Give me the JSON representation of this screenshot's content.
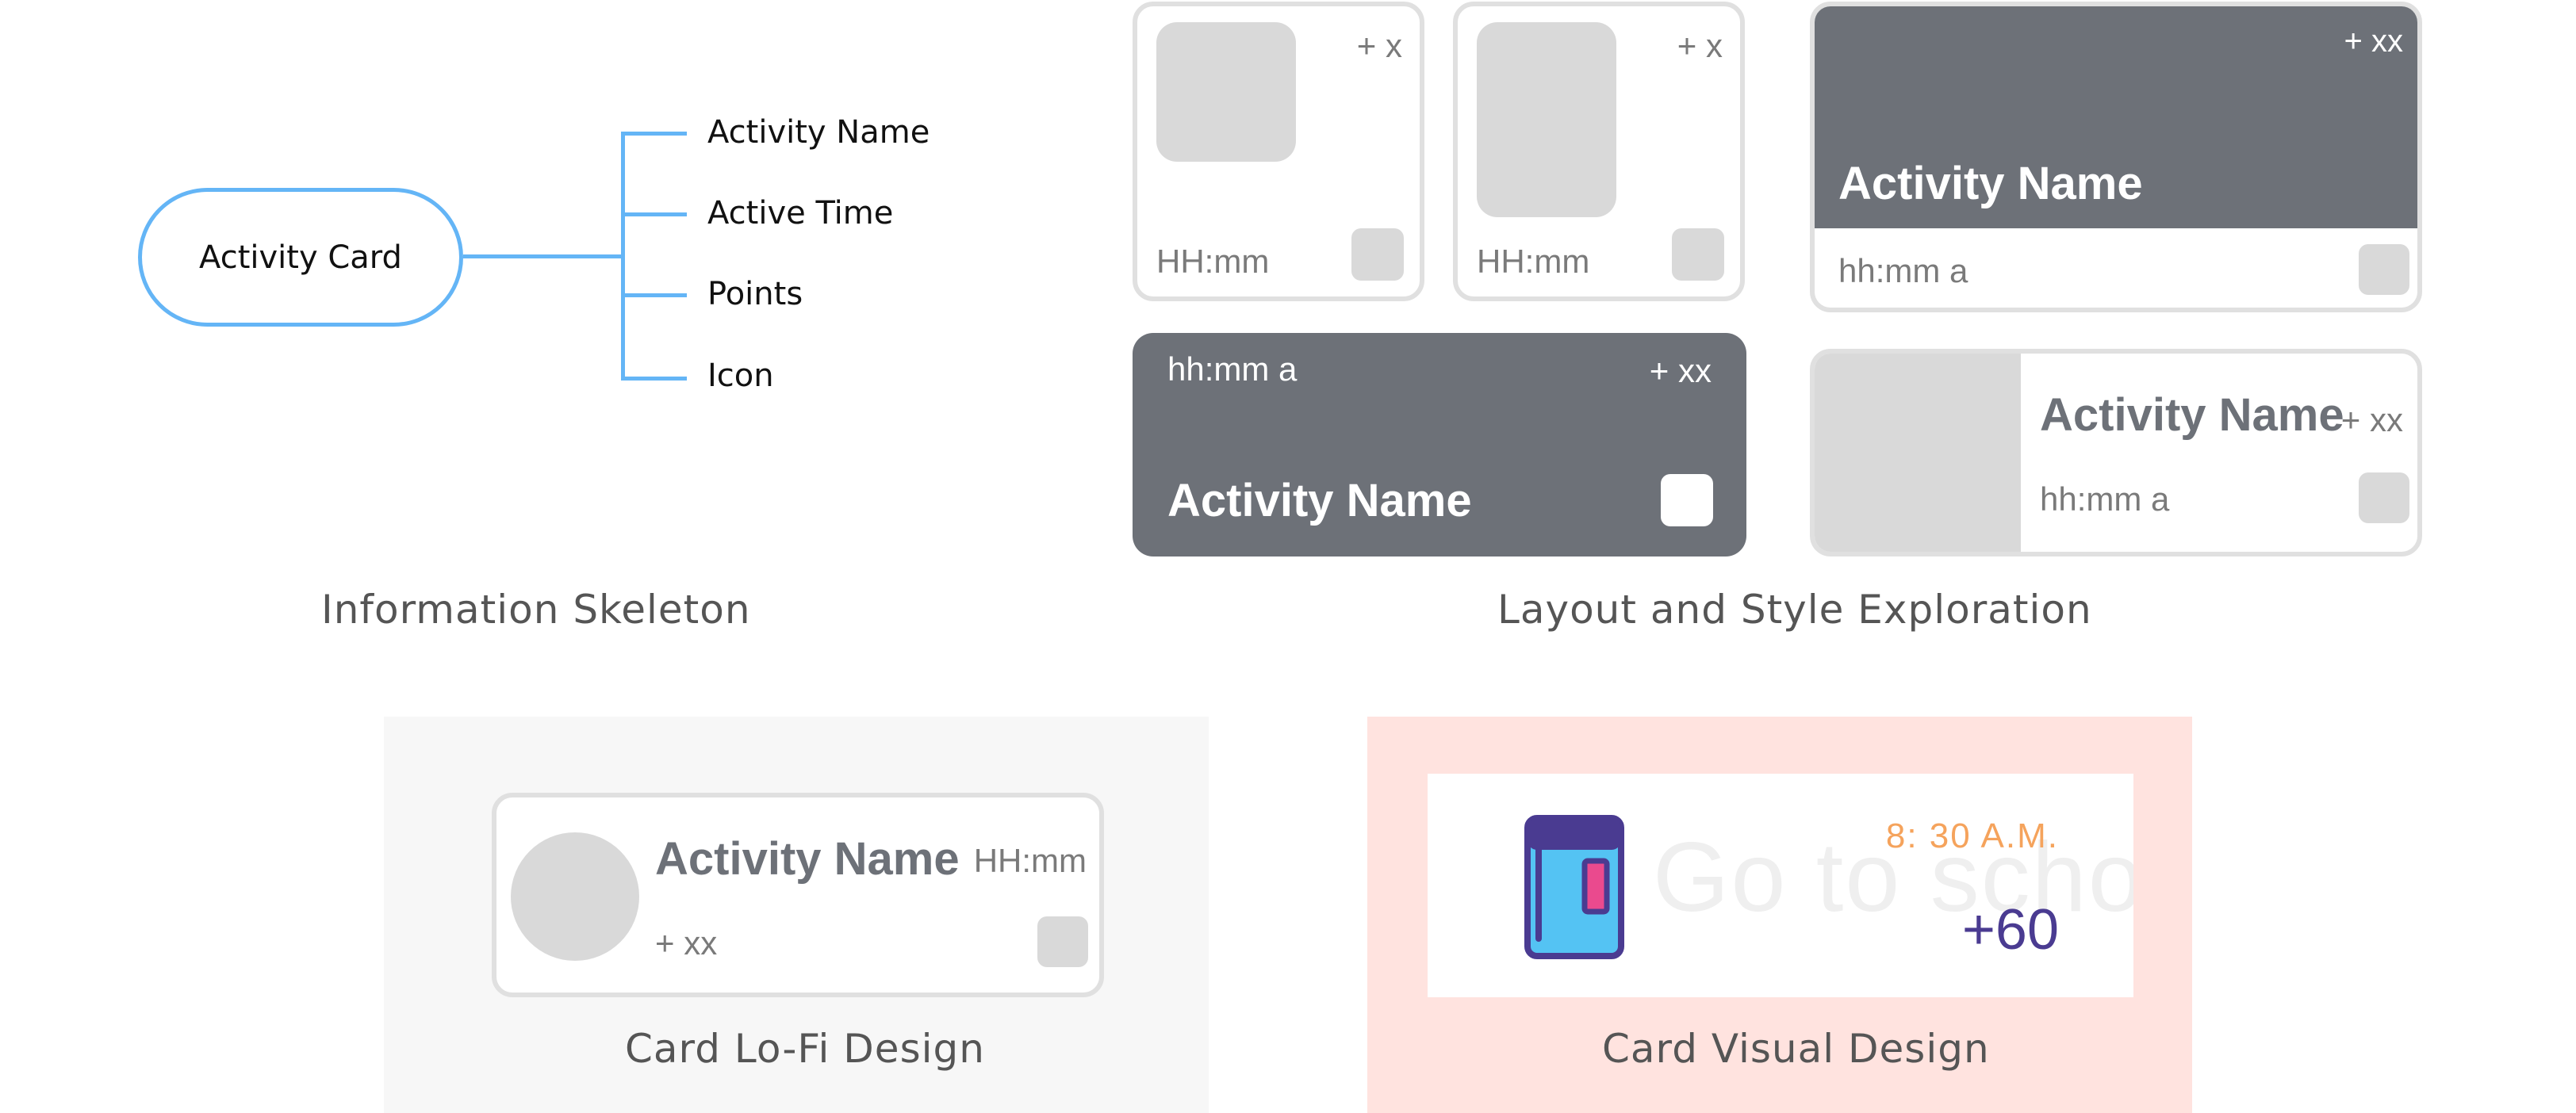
{
  "skeleton": {
    "root": "Activity Card",
    "children": [
      "Activity Name",
      "Active Time",
      "Points",
      "Icon"
    ],
    "caption": "Information Skeleton"
  },
  "exploration": {
    "caption": "Layout and Style Exploration",
    "card1": {
      "time": "HH:mm",
      "points": "+ x"
    },
    "card2": {
      "time": "HH:mm",
      "points": "+ x"
    },
    "card3": {
      "title": "Activity Name",
      "points": "+ xx",
      "time": "hh:mm a"
    },
    "card4": {
      "time": "hh:mm a",
      "points": "+ xx",
      "title": "Activity Name"
    },
    "card5": {
      "title": "Activity Name",
      "points": "+ xx",
      "time": "hh:mm a"
    }
  },
  "lofi": {
    "caption": "Card Lo-Fi Design",
    "title": "Activity Name",
    "time": "HH:mm",
    "points": "+ xx"
  },
  "visual": {
    "caption": "Card Visual Design",
    "time": "8: 30 A.M.",
    "points": "+60",
    "watermark": "Go to school"
  },
  "colors": {
    "mind_map_line": "#64b5f6",
    "dark_card": "#6d7178",
    "lofi_panel_bg": "#f7f7f7",
    "visual_panel_bg": "#ffe3df",
    "time_orange": "#f5a35c",
    "points_purple": "#4a3b91"
  }
}
